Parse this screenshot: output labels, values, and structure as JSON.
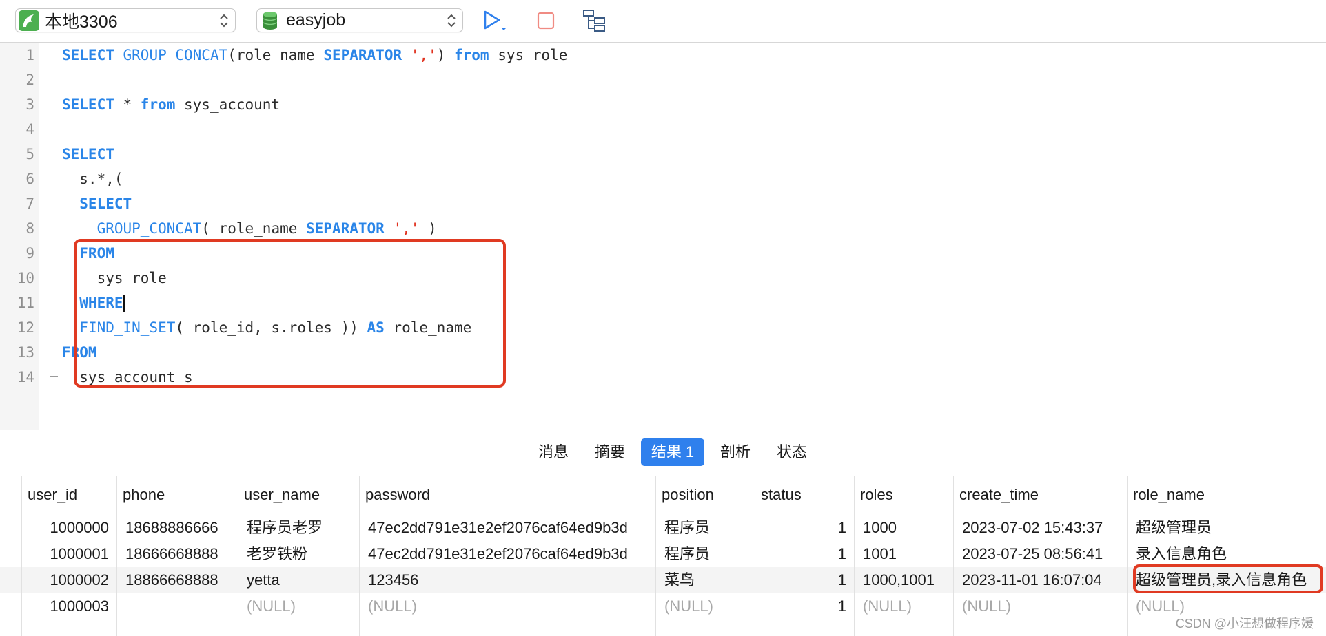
{
  "toolbar": {
    "connection": "本地3306",
    "database": "easyjob",
    "icons": [
      "mysql-connection-icon",
      "database-icon",
      "run-icon",
      "stop-icon",
      "explain-icon"
    ],
    "colors": {
      "mysql_green": "#4caf50",
      "db_green": "#3a8f3a",
      "run_blue": "#2f80ed",
      "stop_red": "#e85a4f"
    }
  },
  "editor": {
    "lines": [
      {
        "n": "1",
        "segments": [
          [
            "kw",
            "SELECT"
          ],
          [
            "t",
            " "
          ],
          [
            "fn",
            "GROUP_CONCAT"
          ],
          [
            "t",
            "(role_name "
          ],
          [
            "kw",
            "SEPARATOR"
          ],
          [
            "t",
            " "
          ],
          [
            "str",
            "','"
          ],
          [
            "t",
            ") "
          ],
          [
            "kw",
            "from"
          ],
          [
            "t",
            " sys_role"
          ]
        ]
      },
      {
        "n": "2",
        "segments": []
      },
      {
        "n": "3",
        "segments": [
          [
            "kw",
            "SELECT"
          ],
          [
            "t",
            " * "
          ],
          [
            "kw",
            "from"
          ],
          [
            "t",
            " sys_account"
          ]
        ]
      },
      {
        "n": "4",
        "segments": []
      },
      {
        "n": "5",
        "segments": [
          [
            "kw",
            "SELECT"
          ]
        ]
      },
      {
        "n": "6",
        "segments": [
          [
            "t",
            "  s.*,("
          ]
        ]
      },
      {
        "n": "7",
        "segments": [
          [
            "kw",
            "  SELECT"
          ]
        ]
      },
      {
        "n": "8",
        "segments": [
          [
            "t",
            "    "
          ],
          [
            "fn",
            "GROUP_CONCAT"
          ],
          [
            "t",
            "( role_name "
          ],
          [
            "kw",
            "SEPARATOR"
          ],
          [
            "t",
            " "
          ],
          [
            "str",
            "','"
          ],
          [
            "t",
            " )"
          ]
        ]
      },
      {
        "n": "9",
        "segments": [
          [
            "kw",
            "  FROM"
          ]
        ]
      },
      {
        "n": "10",
        "segments": [
          [
            "t",
            "    sys_role"
          ]
        ]
      },
      {
        "n": "11",
        "segments": [
          [
            "kw",
            "  WHERE"
          ],
          [
            "caret",
            ""
          ]
        ]
      },
      {
        "n": "12",
        "segments": [
          [
            "t",
            "  "
          ],
          [
            "fn",
            "FIND_IN_SET"
          ],
          [
            "t",
            "( role_id, s.roles )) "
          ],
          [
            "kw",
            "AS"
          ],
          [
            "t",
            " role_name"
          ]
        ]
      },
      {
        "n": "13",
        "segments": [
          [
            "kw",
            "FROM"
          ]
        ]
      },
      {
        "n": "14",
        "segments": [
          [
            "t",
            "  sys_account s"
          ]
        ]
      }
    ]
  },
  "tabs": [
    {
      "label": "消息",
      "active": false
    },
    {
      "label": "摘要",
      "active": false
    },
    {
      "label": "结果 1",
      "active": true
    },
    {
      "label": "剖析",
      "active": false
    },
    {
      "label": "状态",
      "active": false
    }
  ],
  "grid": {
    "columns": [
      "user_id",
      "phone",
      "user_name",
      "password",
      "position",
      "status",
      "roles",
      "create_time",
      "role_name"
    ],
    "rows": [
      [
        "1000000",
        "18688886666",
        "程序员老罗",
        "47ec2dd791e31e2ef2076caf64ed9b3d",
        "程序员",
        "1",
        "1000",
        "2023-07-02 15:43:37",
        "超级管理员"
      ],
      [
        "1000001",
        "18666668888",
        "老罗铁粉",
        "47ec2dd791e31e2ef2076caf64ed9b3d",
        "程序员",
        "1",
        "1001",
        "2023-07-25 08:56:41",
        "录入信息角色"
      ],
      [
        "1000002",
        "18866668888",
        "yetta",
        "123456",
        "菜鸟",
        "1",
        "1000,1001",
        "2023-11-01 16:07:04",
        "超级管理员,录入信息角色"
      ],
      [
        "1000003",
        "",
        "(NULL)",
        "(NULL)",
        "(NULL)",
        "1",
        "(NULL)",
        "(NULL)",
        "(NULL)"
      ]
    ]
  },
  "watermark": "CSDN @小汪想做程序媛"
}
